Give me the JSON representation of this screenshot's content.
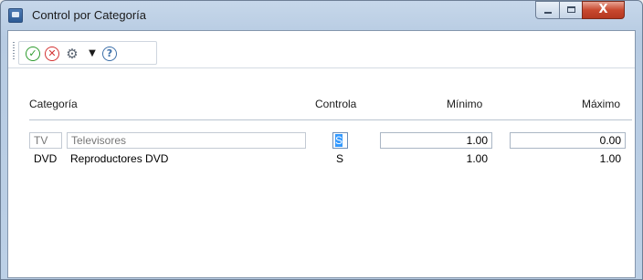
{
  "window": {
    "title": "Control por Categoría",
    "close_glyph": "X"
  },
  "toolbar": {
    "icons": [
      "ok-icon",
      "cancel-icon",
      "gear-icon",
      "dropdown-icon",
      "help-icon"
    ],
    "ok_glyph": "✓",
    "cancel_glyph": "✕",
    "gear_glyph": "⚙",
    "dropdown_glyph": "▼",
    "help_glyph": "?"
  },
  "grid": {
    "headers": {
      "categoria": "Categoría",
      "controla": "Controla",
      "minimo": "Mínimo",
      "maximo": "Máximo"
    },
    "rows": [
      {
        "code": "TV",
        "name": "Televisores",
        "controla": "S",
        "minimo": "1.00",
        "maximo": "0.00"
      },
      {
        "code": "DVD",
        "name": "Reproductores DVD",
        "controla": "S",
        "minimo": "1.00",
        "maximo": "1.00"
      }
    ]
  },
  "colors": {
    "selection": "#3399ff",
    "ok": "#2e9b2e",
    "cancel": "#d33232",
    "close_button": "#c8492f"
  }
}
